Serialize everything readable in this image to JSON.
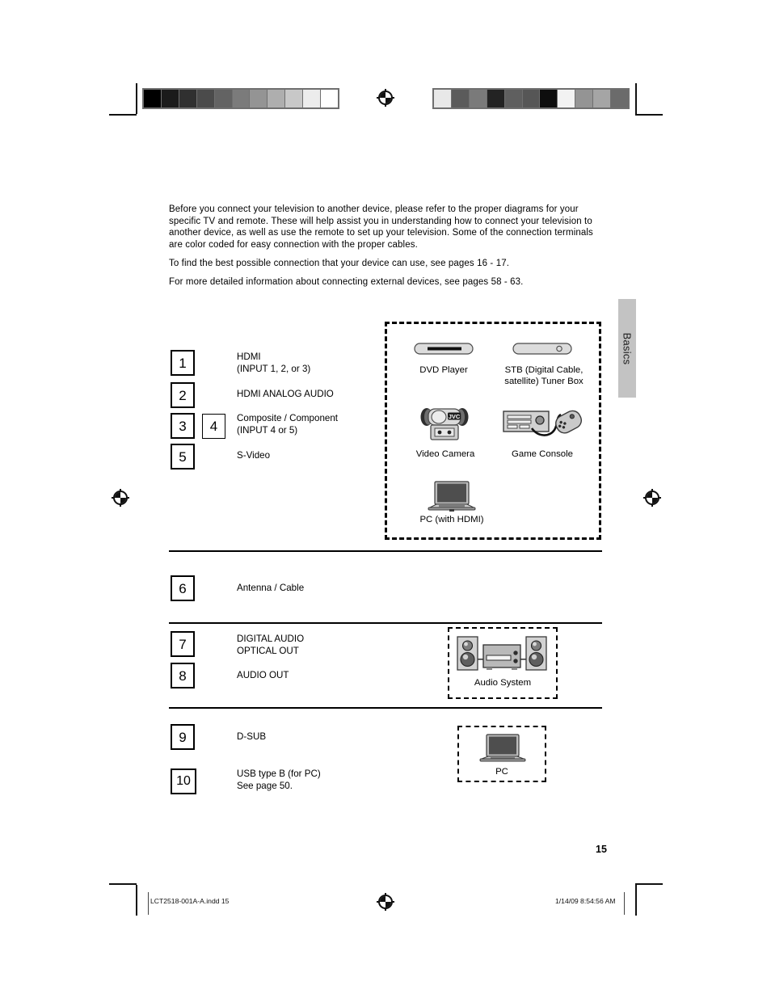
{
  "page": {
    "number": "15",
    "side_tab": "Basics"
  },
  "intro": {
    "paragraph1": "Before you connect your television to another device, please refer to the proper diagrams for your specific TV and remote.  These will help assist you in understanding how to connect your television to another device, as well as use the remote to set up your television.  Some of the connection terminals are color coded for easy connection with the proper cables.",
    "paragraph2": "To find the best possible connection that your device can use, see pages 16 - 17.",
    "paragraph3": "For more detailed information about connecting external devices, see pages 58 - 63."
  },
  "connections": {
    "group1": [
      {
        "numbers": [
          "1"
        ],
        "label": "HDMI\n(INPUT 1, 2, or 3)"
      },
      {
        "numbers": [
          "2"
        ],
        "label": "HDMI ANALOG AUDIO"
      },
      {
        "numbers": [
          "3",
          "4"
        ],
        "label": "Composite / Component\n(INPUT 4 or 5)"
      },
      {
        "numbers": [
          "5"
        ],
        "label": "S-Video"
      }
    ],
    "group2": [
      {
        "numbers": [
          "6"
        ],
        "label": "Antenna / Cable"
      }
    ],
    "group3": [
      {
        "numbers": [
          "7"
        ],
        "label": "DIGITAL AUDIO\nOPTICAL OUT"
      },
      {
        "numbers": [
          "8"
        ],
        "label": "AUDIO OUT"
      }
    ],
    "group4": [
      {
        "numbers": [
          "9"
        ],
        "label": "D-SUB"
      },
      {
        "numbers": [
          "10"
        ],
        "label": "USB type B (for PC)\nSee page 50."
      }
    ]
  },
  "devices": {
    "video_group": [
      {
        "icon": "dvd-player-icon",
        "label": "DVD Player"
      },
      {
        "icon": "stb-tuner-box-icon",
        "label": "STB (Digital Cable,\nsatellite) Tuner Box"
      },
      {
        "icon": "video-camera-icon",
        "label": "Video Camera"
      },
      {
        "icon": "game-console-icon",
        "label": "Game Console"
      },
      {
        "icon": "laptop-icon",
        "label": "PC (with HDMI)"
      }
    ],
    "audio_group": [
      {
        "icon": "audio-system-icon",
        "label": "Audio System"
      }
    ],
    "pc_group": [
      {
        "icon": "laptop-icon",
        "label": "PC"
      }
    ],
    "camera_brand": "JVC"
  },
  "footer": {
    "file_name": "LCT2518-001A-A.indd   15",
    "timestamp": "1/14/09   8:54:56 AM"
  },
  "colorbars": {
    "left_ramp": [
      "#000000",
      "#1b1b1b",
      "#303030",
      "#4b4b4b",
      "#636363",
      "#7b7b7b",
      "#949494",
      "#aeaeae",
      "#c8c8c8",
      "#ececec",
      "#ffffff"
    ],
    "right_patches": [
      "#e8e8e8",
      "#5b5b5b",
      "#7a7a7a",
      "#232323",
      "#5f5f5f",
      "#565656",
      "#0e0e0e",
      "#f2f2f2",
      "#949494",
      "#a5a5a5",
      "#6b6b6b"
    ]
  }
}
